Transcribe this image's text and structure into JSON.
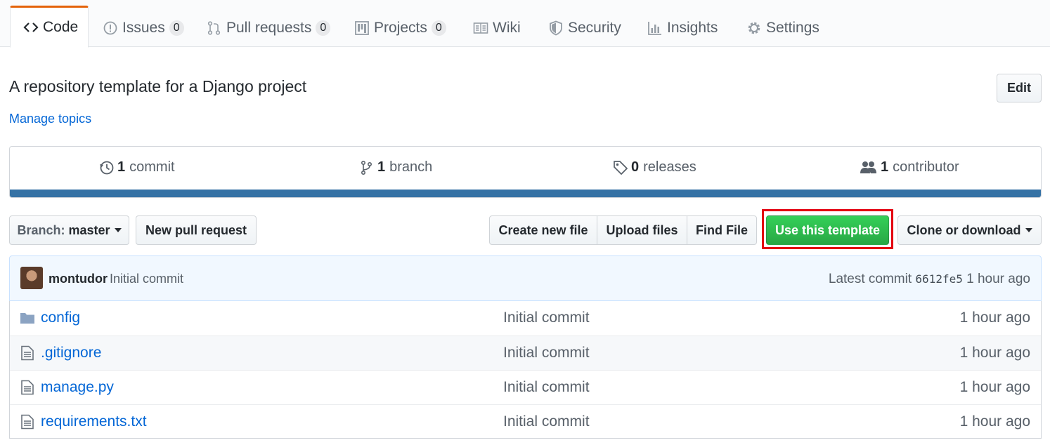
{
  "tabs": [
    {
      "label": "Code",
      "icon": "code-icon",
      "selected": true
    },
    {
      "label": "Issues",
      "icon": "issue-icon",
      "count": "0"
    },
    {
      "label": "Pull requests",
      "icon": "pull-request-icon",
      "count": "0"
    },
    {
      "label": "Projects",
      "icon": "project-icon",
      "count": "0"
    },
    {
      "label": "Wiki",
      "icon": "book-icon"
    },
    {
      "label": "Security",
      "icon": "shield-icon"
    },
    {
      "label": "Insights",
      "icon": "graph-icon"
    },
    {
      "label": "Settings",
      "icon": "gear-icon"
    }
  ],
  "repo": {
    "description": "A repository template for a Django project",
    "manage_topics": "Manage topics",
    "edit_label": "Edit"
  },
  "summary": {
    "commits": {
      "count": "1",
      "label": "commit"
    },
    "branches": {
      "count": "1",
      "label": "branch"
    },
    "releases": {
      "count": "0",
      "label": "releases"
    },
    "contributors": {
      "count": "1",
      "label": "contributor"
    },
    "language_color": "#3572a5"
  },
  "toolbar": {
    "branch_prefix": "Branch:",
    "branch_name": "master",
    "new_pr": "New pull request",
    "create_file": "Create new file",
    "upload_files": "Upload files",
    "find_file": "Find File",
    "use_template": "Use this template",
    "clone": "Clone or download"
  },
  "commit": {
    "author": "montudor",
    "message": "Initial commit",
    "latest_label": "Latest commit",
    "sha": "6612fe5",
    "age": "1 hour ago"
  },
  "files": [
    {
      "name": "config",
      "type": "folder",
      "message": "Initial commit",
      "age": "1 hour ago"
    },
    {
      "name": ".gitignore",
      "type": "file",
      "message": "Initial commit",
      "age": "1 hour ago"
    },
    {
      "name": "manage.py",
      "type": "file",
      "message": "Initial commit",
      "age": "1 hour ago"
    },
    {
      "name": "requirements.txt",
      "type": "file",
      "message": "Initial commit",
      "age": "1 hour ago"
    }
  ],
  "colors": {
    "accent": "#0366d6",
    "primary_button": "#28a745",
    "highlight": "#e3000f",
    "tab_accent": "#e36209"
  }
}
